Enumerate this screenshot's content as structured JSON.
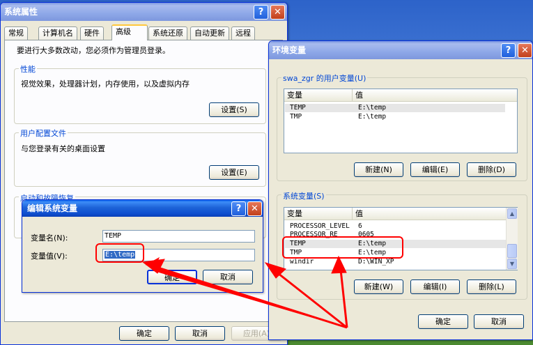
{
  "sys_props": {
    "title": "系统属性",
    "tabs": [
      "常规",
      "计算机名",
      "硬件",
      "高级",
      "系统还原",
      "自动更新",
      "远程"
    ],
    "admin_note": "要进行大多数改动，您必须作为管理员登录。",
    "perf": {
      "label": "性能",
      "desc": "视觉效果，处理器计划，内存使用，以及虚拟内存",
      "button": "设置(S)"
    },
    "profile": {
      "label": "用户配置文件",
      "desc": "与您登录有关的桌面设置",
      "button": "设置(E)"
    },
    "startup": {
      "label": "启动和故障恢复"
    },
    "ok": "确定",
    "cancel": "取消",
    "apply": "应用(A)"
  },
  "env": {
    "title": "环境变量",
    "user_group": "swa_zgr 的用户变量(U)",
    "col_var": "变量",
    "col_val": "值",
    "user_vars": [
      {
        "name": "TEMP",
        "value": "E:\\temp"
      },
      {
        "name": "TMP",
        "value": "E:\\temp"
      }
    ],
    "new": "新建(N)",
    "edit": "编辑(E)",
    "delete": "删除(D)",
    "sys_group": "系统变量(S)",
    "sys_vars": [
      {
        "name": "PROCESSOR_LEVEL",
        "value": "6"
      },
      {
        "name": "PROCESSOR_RE",
        "value": "0605"
      },
      {
        "name": "TEMP",
        "value": "E:\\temp"
      },
      {
        "name": "TMP",
        "value": "E:\\temp"
      },
      {
        "name": "windir",
        "value": "D:\\WIN_XP"
      }
    ],
    "sys_new": "新建(W)",
    "sys_edit": "编辑(I)",
    "sys_delete": "删除(L)",
    "ok": "确定",
    "cancel": "取消"
  },
  "edit_dlg": {
    "title": "编辑系统变量",
    "name_label": "变量名(N):",
    "name_value": "TEMP",
    "value_label": "变量值(V):",
    "value_value": "E:\\temp",
    "ok": "确定",
    "cancel": "取消"
  },
  "colors": {
    "annotation": "#ff0000",
    "title_active": "#0a5de8"
  }
}
